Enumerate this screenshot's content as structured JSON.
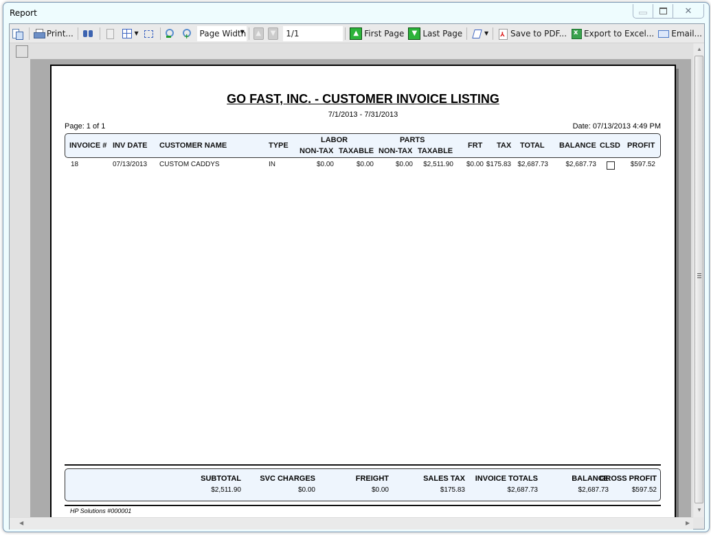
{
  "window": {
    "title": "Report",
    "controls": {
      "minimize": "minimize",
      "maximize": "restore",
      "close": "close"
    }
  },
  "toolbar": {
    "print_label": "Print...",
    "zoom_mode": "Page Width",
    "page_indicator": "1/1",
    "first_page_label": "First Page",
    "last_page_label": "Last Page",
    "save_pdf_label": "Save to PDF...",
    "export_excel_label": "Export to Excel...",
    "email_label": "Email..."
  },
  "report": {
    "title": "GO FAST, INC. - CUSTOMER INVOICE LISTING",
    "date_range": "7/1/2013 - 7/31/2013",
    "page_info": "Page: 1 of 1",
    "printed_date": "Date: 07/13/2013 4:49 PM",
    "headers": {
      "invoice": "INVOICE #",
      "inv_date": "INV DATE",
      "customer": "CUSTOMER NAME",
      "type": "TYPE",
      "labor": "LABOR",
      "parts": "PARTS",
      "non_tax": "NON-TAX",
      "taxable": "TAXABLE",
      "frt": "FRT",
      "tax": "TAX",
      "total": "TOTAL",
      "balance": "BALANCE",
      "clsd": "CLSD",
      "profit": "PROFIT"
    },
    "rows": [
      {
        "invoice": "18",
        "inv_date": "07/13/2013",
        "customer": "CUSTOM CADDYS",
        "type": "IN",
        "labor_nontax": "$0.00",
        "labor_taxable": "$0.00",
        "parts_nontax": "$0.00",
        "parts_taxable": "$2,511.90",
        "frt": "$0.00",
        "tax": "$175.83",
        "total": "$2,687.73",
        "balance": "$2,687.73",
        "closed": false,
        "profit": "$597.52"
      }
    ],
    "totals": {
      "subtotal_label": "SUBTOTAL",
      "subtotal": "$2,511.90",
      "svc_label": "SVC CHARGES",
      "svc": "$0.00",
      "freight_label": "FREIGHT",
      "freight": "$0.00",
      "sales_tax_label": "SALES TAX",
      "sales_tax": "$175.83",
      "invoice_totals_label": "INVOICE TOTALS",
      "invoice_totals": "$2,687.73",
      "balance_label": "BALANCE",
      "balance": "$2,687.73",
      "gross_profit_label": "GROSS PROFIT",
      "gross_profit": "$597.52"
    },
    "footer": "HP Solutions #000001"
  }
}
